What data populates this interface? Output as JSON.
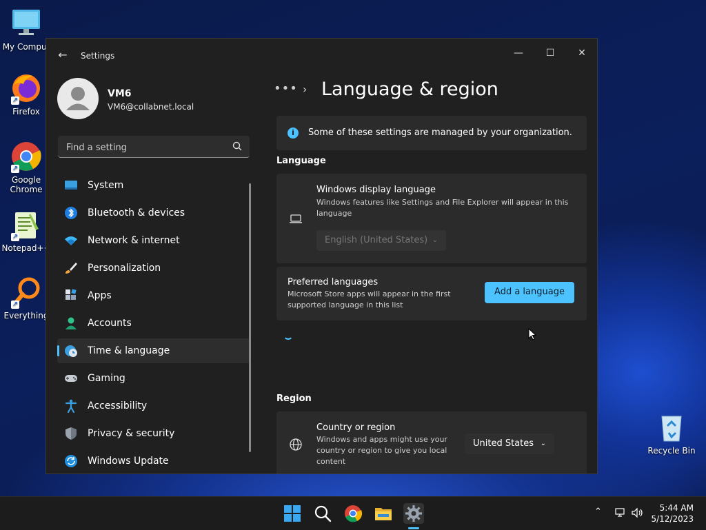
{
  "desktop": {
    "icons": [
      {
        "label": "My Comput"
      },
      {
        "label": "Firefox"
      },
      {
        "label": "Google Chrome"
      },
      {
        "label": "Notepad++"
      },
      {
        "label": "Everything"
      },
      {
        "label": "Recycle Bin"
      }
    ]
  },
  "window": {
    "app_title": "Settings",
    "controls": {
      "minimize": "—",
      "maximize": "☐",
      "close": "✕"
    }
  },
  "sidebar": {
    "user": {
      "name": "VM6",
      "email": "VM6@collabnet.local"
    },
    "search_placeholder": "Find a setting",
    "items": [
      {
        "label": "System",
        "icon": "system-icon"
      },
      {
        "label": "Bluetooth & devices",
        "icon": "bluetooth-icon"
      },
      {
        "label": "Network & internet",
        "icon": "wifi-icon"
      },
      {
        "label": "Personalization",
        "icon": "brush-icon"
      },
      {
        "label": "Apps",
        "icon": "apps-icon"
      },
      {
        "label": "Accounts",
        "icon": "accounts-icon"
      },
      {
        "label": "Time & language",
        "icon": "time-language-icon",
        "active": true
      },
      {
        "label": "Gaming",
        "icon": "gamepad-icon"
      },
      {
        "label": "Accessibility",
        "icon": "accessibility-icon"
      },
      {
        "label": "Privacy & security",
        "icon": "shield-icon"
      },
      {
        "label": "Windows Update",
        "icon": "update-icon"
      }
    ]
  },
  "main": {
    "breadcrumb_more": "•••",
    "title": "Language & region",
    "banner": "Some of these settings are managed by your organization.",
    "language": {
      "heading": "Language",
      "display_language": {
        "title": "Windows display language",
        "desc": "Windows features like Settings and File Explorer will appear in this language",
        "value": "English (United States)"
      },
      "preferred": {
        "title": "Preferred languages",
        "desc": "Microsoft Store apps will appear in the first supported language in this list",
        "button": "Add a language"
      }
    },
    "region": {
      "heading": "Region",
      "country": {
        "title": "Country or region",
        "desc": "Windows and apps might use your country or region to give you local content",
        "value": "United States"
      }
    }
  },
  "taskbar": {
    "time": "5:44 AM",
    "date": "5/12/2023",
    "accent": "#4cc2ff"
  }
}
